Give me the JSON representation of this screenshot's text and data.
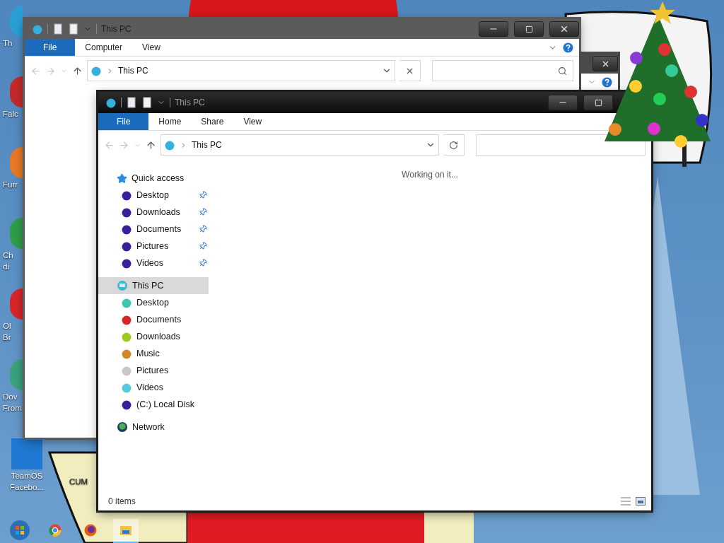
{
  "desktop": {
    "icons": [
      {
        "lines": [
          "Th"
        ]
      },
      {
        "lines": [
          "Falc"
        ]
      },
      {
        "lines": [
          "Furr"
        ]
      },
      {
        "lines": [
          "Ch",
          "di"
        ]
      },
      {
        "lines": [
          "Ol",
          "Br"
        ]
      },
      {
        "lines": [
          "Dov",
          "From"
        ]
      },
      {
        "lines": [
          "TeamOS",
          "Facebo..."
        ]
      }
    ],
    "second_column_icon": {
      "lines": [
        "CUM"
      ]
    }
  },
  "back_window": {
    "title": "This PC",
    "tabs": [
      {
        "label": "File",
        "kind": "file"
      },
      {
        "label": "Computer",
        "kind": "tab"
      },
      {
        "label": "View",
        "kind": "tab"
      }
    ],
    "address": "This PC"
  },
  "front_window": {
    "title": "This PC",
    "tabs": [
      {
        "label": "File",
        "kind": "file"
      },
      {
        "label": "Home",
        "kind": "tab"
      },
      {
        "label": "Share",
        "kind": "tab"
      },
      {
        "label": "View",
        "kind": "tab"
      }
    ],
    "address": "This PC",
    "navigation": [
      {
        "label": "Quick access",
        "kind": "star",
        "selected": false,
        "children": [
          {
            "label": "Desktop",
            "color": "#3a1f9a",
            "pinned": true,
            "selected": false
          },
          {
            "label": "Downloads",
            "color": "#3a1f9a",
            "pinned": true,
            "selected": false
          },
          {
            "label": "Documents",
            "color": "#3a1f9a",
            "pinned": true,
            "selected": false
          },
          {
            "label": "Pictures",
            "color": "#3a1f9a",
            "pinned": true,
            "selected": false
          },
          {
            "label": "Videos",
            "color": "#3a1f9a",
            "pinned": true,
            "selected": false
          }
        ]
      },
      {
        "label": "This PC",
        "kind": "computer",
        "selected": true,
        "children": [
          {
            "label": "Desktop",
            "color": "#3fc7b0",
            "pinned": false,
            "selected": false
          },
          {
            "label": "Documents",
            "color": "#d8262b",
            "pinned": false,
            "selected": false
          },
          {
            "label": "Downloads",
            "color": "#9ccc20",
            "pinned": false,
            "selected": false
          },
          {
            "label": "Music",
            "color": "#d08a2a",
            "pinned": false,
            "selected": false
          },
          {
            "label": "Pictures",
            "color": "#c8c8c8",
            "pinned": false,
            "selected": false
          },
          {
            "label": "Videos",
            "color": "#5cc8e0",
            "pinned": false,
            "selected": false
          },
          {
            "label": "(C:) Local Disk",
            "color": "#3a1f9a",
            "pinned": false,
            "selected": false
          }
        ]
      },
      {
        "label": "Network",
        "kind": "network",
        "selected": false
      }
    ],
    "message": "Working on it...",
    "status": "0 items"
  },
  "taskbar": {
    "apps": [
      {
        "kind": "start",
        "active": false
      },
      {
        "kind": "browser",
        "active": false
      },
      {
        "kind": "fox",
        "active": false
      },
      {
        "kind": "folder",
        "active": true
      }
    ]
  }
}
